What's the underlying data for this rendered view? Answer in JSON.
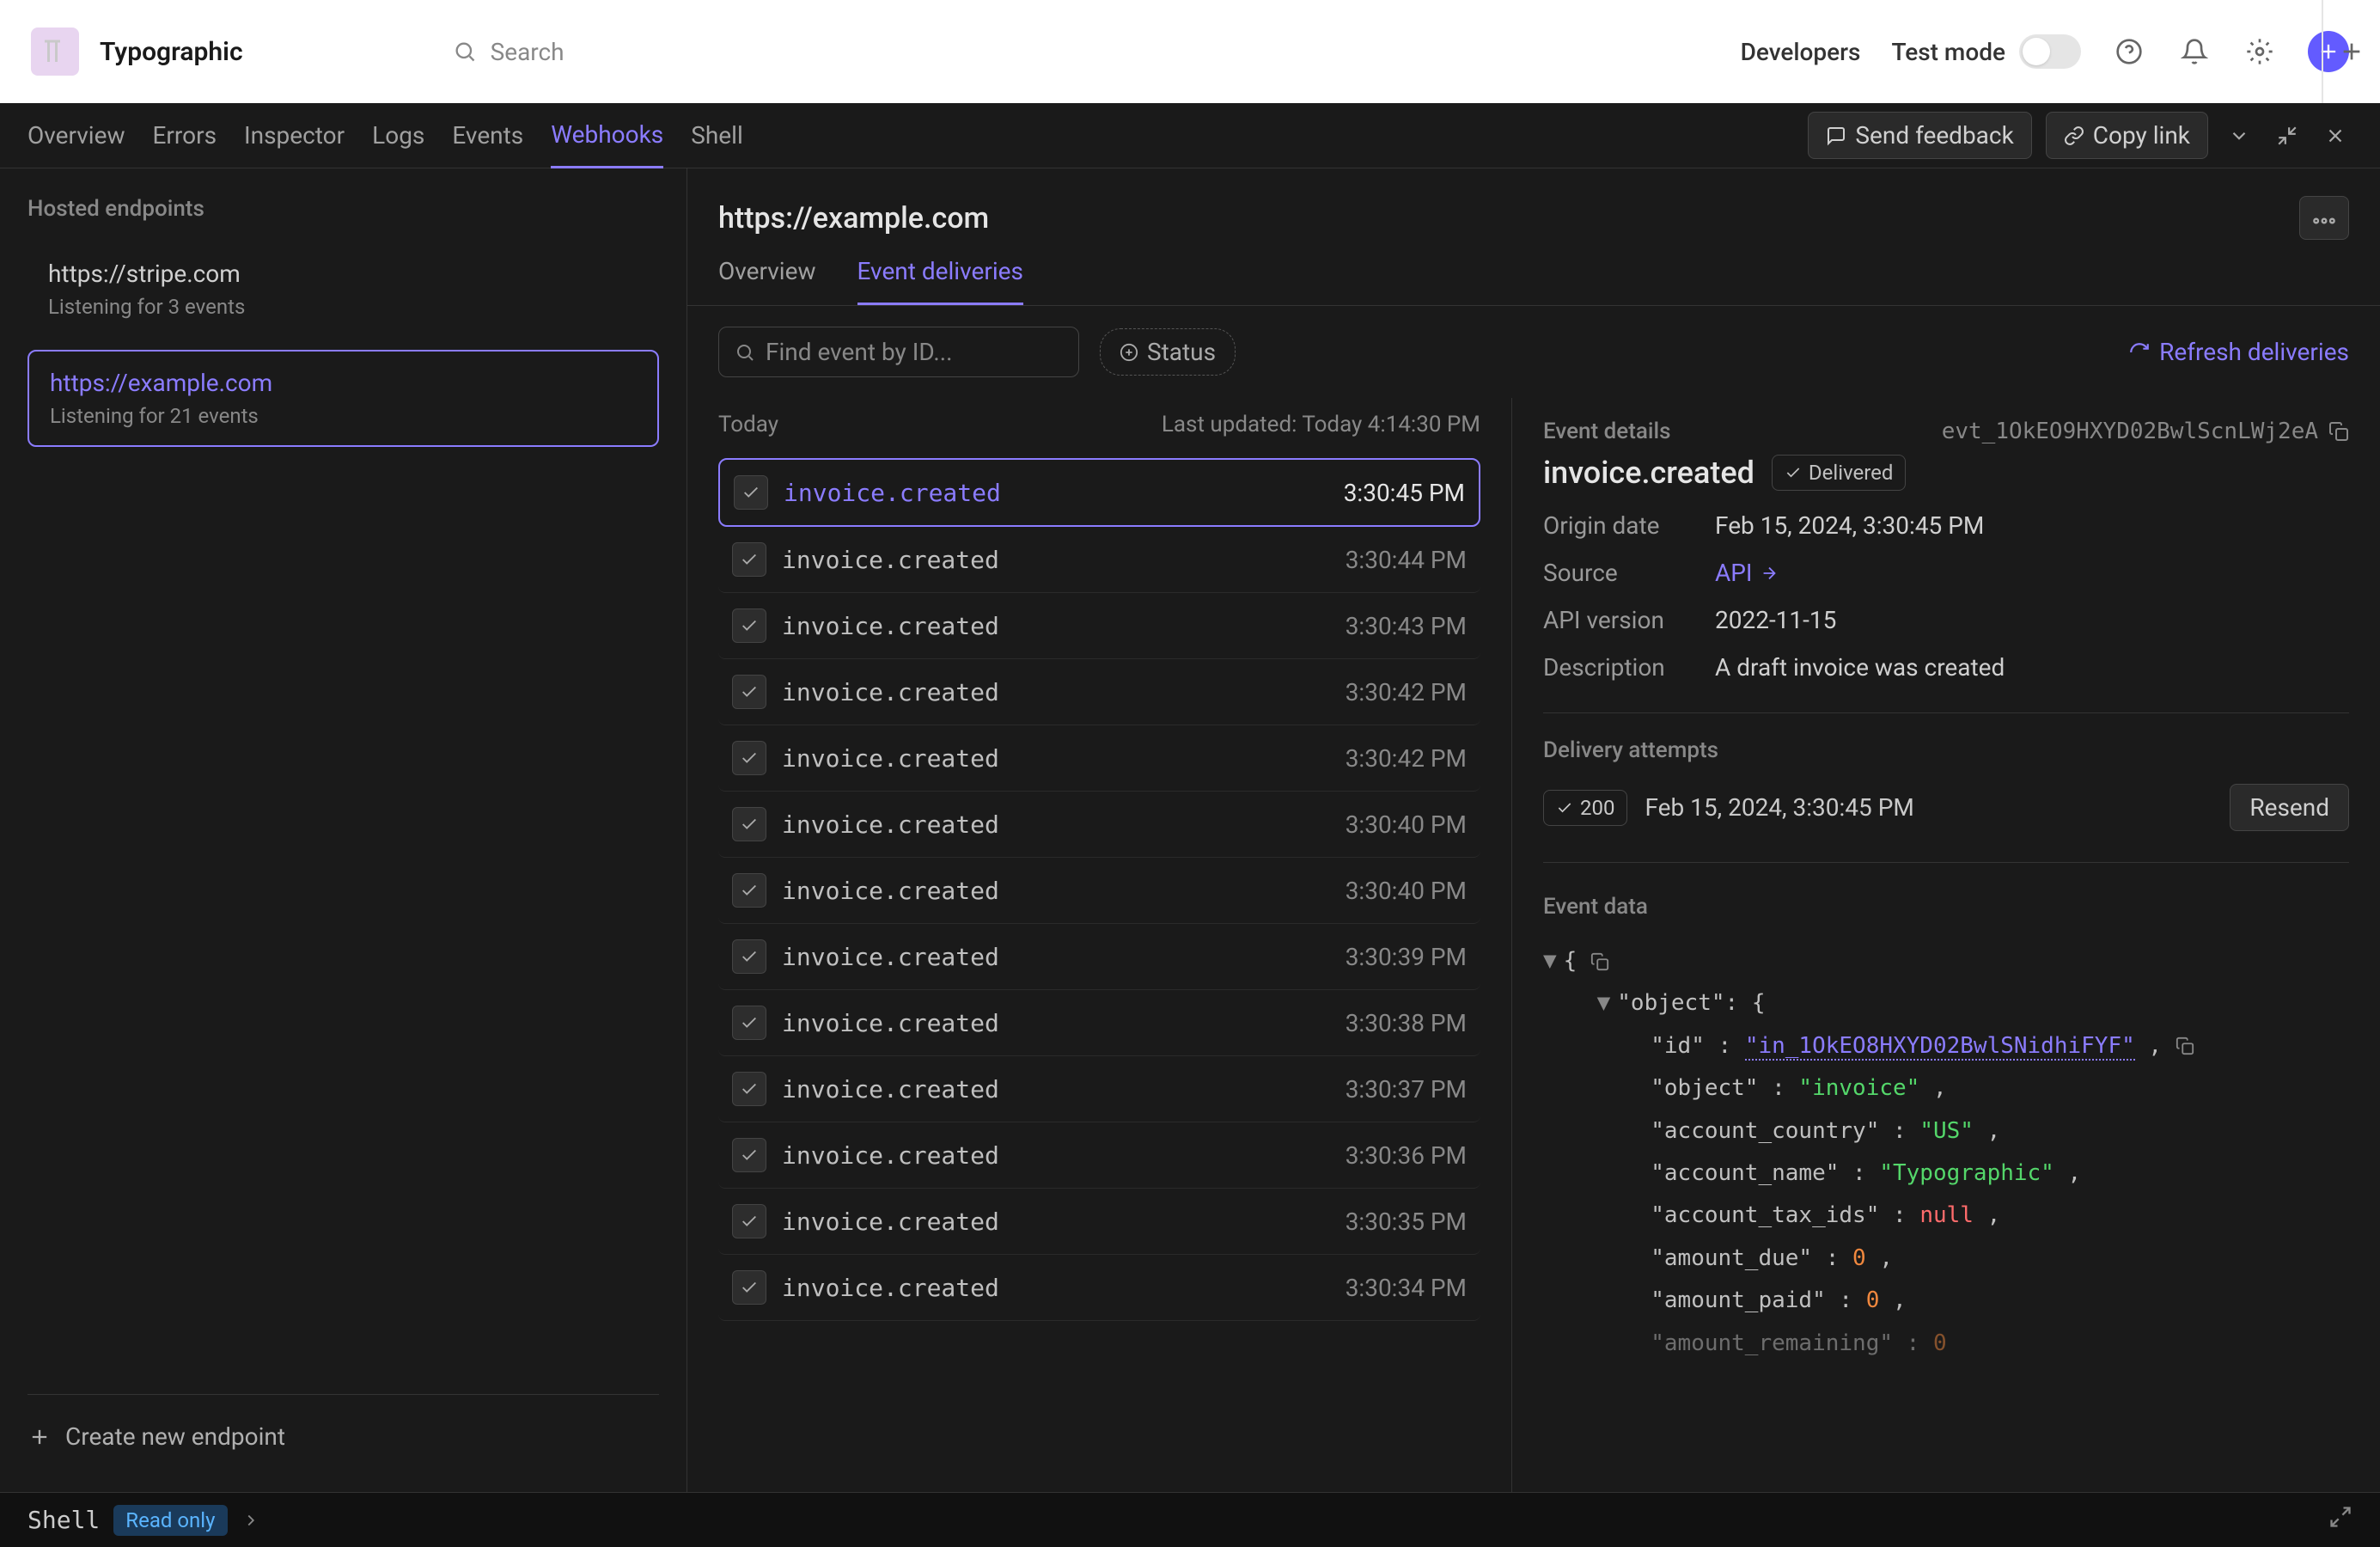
{
  "app": {
    "name": "Typographic",
    "search_placeholder": "Search"
  },
  "topnav": {
    "developers": "Developers",
    "test_mode": "Test mode"
  },
  "tabs": {
    "overview": "Overview",
    "errors": "Errors",
    "inspector": "Inspector",
    "logs": "Logs",
    "events": "Events",
    "webhooks": "Webhooks",
    "shell": "Shell"
  },
  "actions": {
    "send_feedback": "Send feedback",
    "copy_link": "Copy link"
  },
  "sidebar": {
    "label": "Hosted endpoints",
    "endpoints": [
      {
        "url": "https://stripe.com",
        "sub": "Listening for 3 events"
      },
      {
        "url": "https://example.com",
        "sub": "Listening for 21 events"
      }
    ],
    "create": "Create new endpoint"
  },
  "content": {
    "title": "https://example.com",
    "subtabs": {
      "overview": "Overview",
      "deliveries": "Event deliveries"
    },
    "search_placeholder": "Find event by ID...",
    "status_label": "Status",
    "refresh": "Refresh deliveries"
  },
  "list": {
    "heading": "Today",
    "updated": "Last updated: Today 4:14:30 PM",
    "events": [
      {
        "name": "invoice.created",
        "time": "3:30:45 PM"
      },
      {
        "name": "invoice.created",
        "time": "3:30:44 PM"
      },
      {
        "name": "invoice.created",
        "time": "3:30:43 PM"
      },
      {
        "name": "invoice.created",
        "time": "3:30:42 PM"
      },
      {
        "name": "invoice.created",
        "time": "3:30:42 PM"
      },
      {
        "name": "invoice.created",
        "time": "3:30:40 PM"
      },
      {
        "name": "invoice.created",
        "time": "3:30:40 PM"
      },
      {
        "name": "invoice.created",
        "time": "3:30:39 PM"
      },
      {
        "name": "invoice.created",
        "time": "3:30:38 PM"
      },
      {
        "name": "invoice.created",
        "time": "3:30:37 PM"
      },
      {
        "name": "invoice.created",
        "time": "3:30:36 PM"
      },
      {
        "name": "invoice.created",
        "time": "3:30:35 PM"
      },
      {
        "name": "invoice.created",
        "time": "3:30:34 PM"
      }
    ]
  },
  "details": {
    "section_label": "Event details",
    "event_id": "evt_1OkEO9HXYD02BwlScnLWj2eA",
    "title": "invoice.created",
    "delivered": "Delivered",
    "meta": {
      "origin_date_label": "Origin date",
      "origin_date": "Feb 15, 2024, 3:30:45 PM",
      "source_label": "Source",
      "source": "API",
      "api_version_label": "API version",
      "api_version": "2022-11-15",
      "description_label": "Description",
      "description": "A draft invoice was created"
    },
    "attempts_label": "Delivery attempts",
    "attempt": {
      "code": "200",
      "time": "Feb 15, 2024, 3:30:45 PM",
      "resend": "Resend"
    },
    "event_data_label": "Event data",
    "json": {
      "id": "\"in_1OkEO8HXYD02BwlSNidhiFYF\"",
      "object": "\"invoice\"",
      "account_country": "\"US\"",
      "account_name": "\"Typographic\"",
      "account_tax_ids": "null",
      "amount_due": "0",
      "amount_paid": "0",
      "amount_remaining": "0"
    }
  },
  "shell": {
    "label": "Shell",
    "readonly": "Read only"
  }
}
